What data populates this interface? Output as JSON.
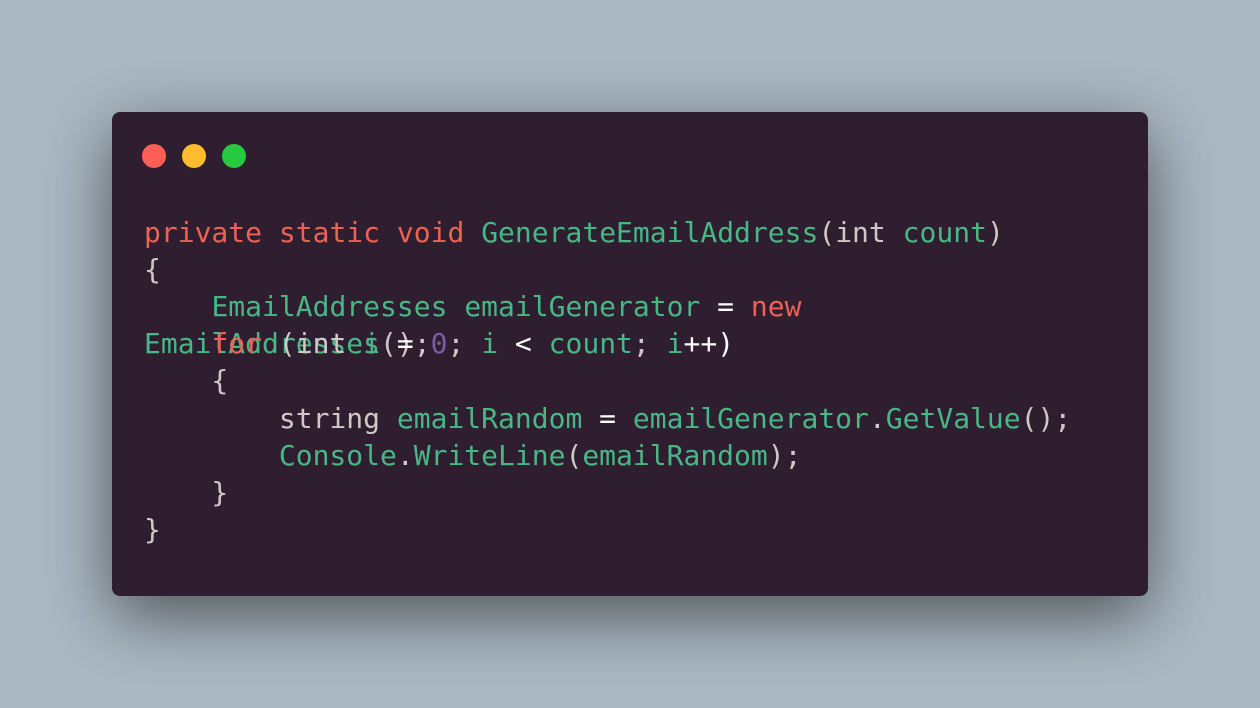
{
  "window": {
    "controls": [
      "close",
      "minimize",
      "maximize"
    ],
    "colors": {
      "background": "#2e1e2f",
      "close": "#ff5f56",
      "minimize": "#ffbd2e",
      "maximize": "#27c93f"
    }
  },
  "code": {
    "line1": {
      "t1": "private",
      "t2": " ",
      "t3": "static",
      "t4": " ",
      "t5": "void",
      "t6": " ",
      "t7": "GenerateEmailAddress",
      "t8": "(",
      "t9": "int",
      "t10": " ",
      "t11": "count",
      "t12": ")"
    },
    "line2": {
      "t1": "{"
    },
    "line3": {
      "t1": "    ",
      "t2": "EmailAddresses",
      "t3": " ",
      "t4": "emailGenerator",
      "t5": " = ",
      "t6": "new"
    },
    "line4a": {
      "t1": "EmailAddresses",
      "t2": "();"
    },
    "line4b": {
      "t1": "    ",
      "t2": "for",
      "t3": " (",
      "t4": "int",
      "t5": " ",
      "t6": "i",
      "t7": " = ",
      "t8": "0",
      "t9": "; ",
      "t10": "i",
      "t11": " < ",
      "t12": "count",
      "t13": "; ",
      "t14": "i",
      "t15": "++)"
    },
    "line5": {
      "t1": "    {"
    },
    "line6": {
      "t1": "        ",
      "t2": "string",
      "t3": " ",
      "t4": "emailRandom",
      "t5": " = ",
      "t6": "emailGenerator",
      "t7": ".",
      "t8": "GetValue",
      "t9": "();"
    },
    "line7": {
      "t1": "        ",
      "t2": "Console",
      "t3": ".",
      "t4": "WriteLine",
      "t5": "(",
      "t6": "emailRandom",
      "t7": ");"
    },
    "line8": {
      "t1": "    }"
    },
    "line9": {
      "t1": "}"
    }
  }
}
